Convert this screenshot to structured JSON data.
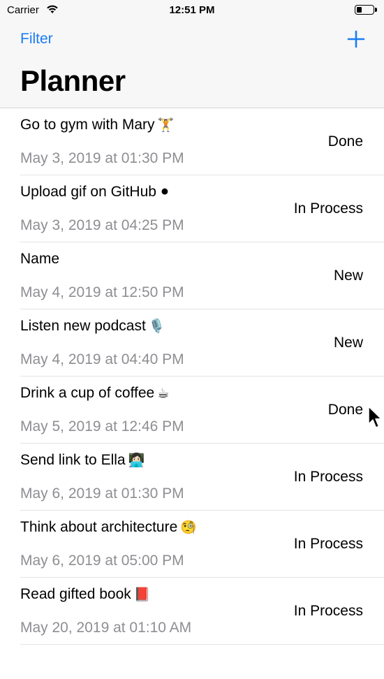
{
  "status_bar": {
    "carrier": "Carrier",
    "time": "12:51 PM",
    "battery_level": 0.35
  },
  "nav": {
    "filter_label": "Filter",
    "add_icon": "plus-icon",
    "title": "Planner"
  },
  "colors": {
    "accent": "#1a7cf5",
    "secondary_text": "#8e8e93",
    "separator": "#e3e3e3"
  },
  "tasks": [
    {
      "name": "Go to gym with Mary",
      "emoji": "🏋️",
      "date": "May 3, 2019 at 01:30 PM",
      "status": "Done"
    },
    {
      "name": "Upload gif on GitHub",
      "emoji": "⚫",
      "date": "May 3, 2019 at 04:25 PM",
      "status": "In Process"
    },
    {
      "name": "Name",
      "emoji": "",
      "date": "May 4, 2019 at 12:50 PM",
      "status": "New"
    },
    {
      "name": "Listen new podcast",
      "emoji": "🎙️",
      "date": "May 4, 2019 at 04:40 PM",
      "status": "New"
    },
    {
      "name": "Drink a cup of coffee",
      "emoji": "☕",
      "date": "May 5, 2019 at 12:46 PM",
      "status": "Done"
    },
    {
      "name": "Send link to Ella",
      "emoji": "👩🏻‍💻",
      "date": "May 6, 2019 at 01:30 PM",
      "status": "In Process"
    },
    {
      "name": "Think about architecture",
      "emoji": "🧐",
      "date": "May 6, 2019 at 05:00 PM",
      "status": "In Process"
    },
    {
      "name": "Read gifted book",
      "emoji": "📕",
      "date": "May 20, 2019 at 01:10 AM",
      "status": "In Process"
    }
  ]
}
